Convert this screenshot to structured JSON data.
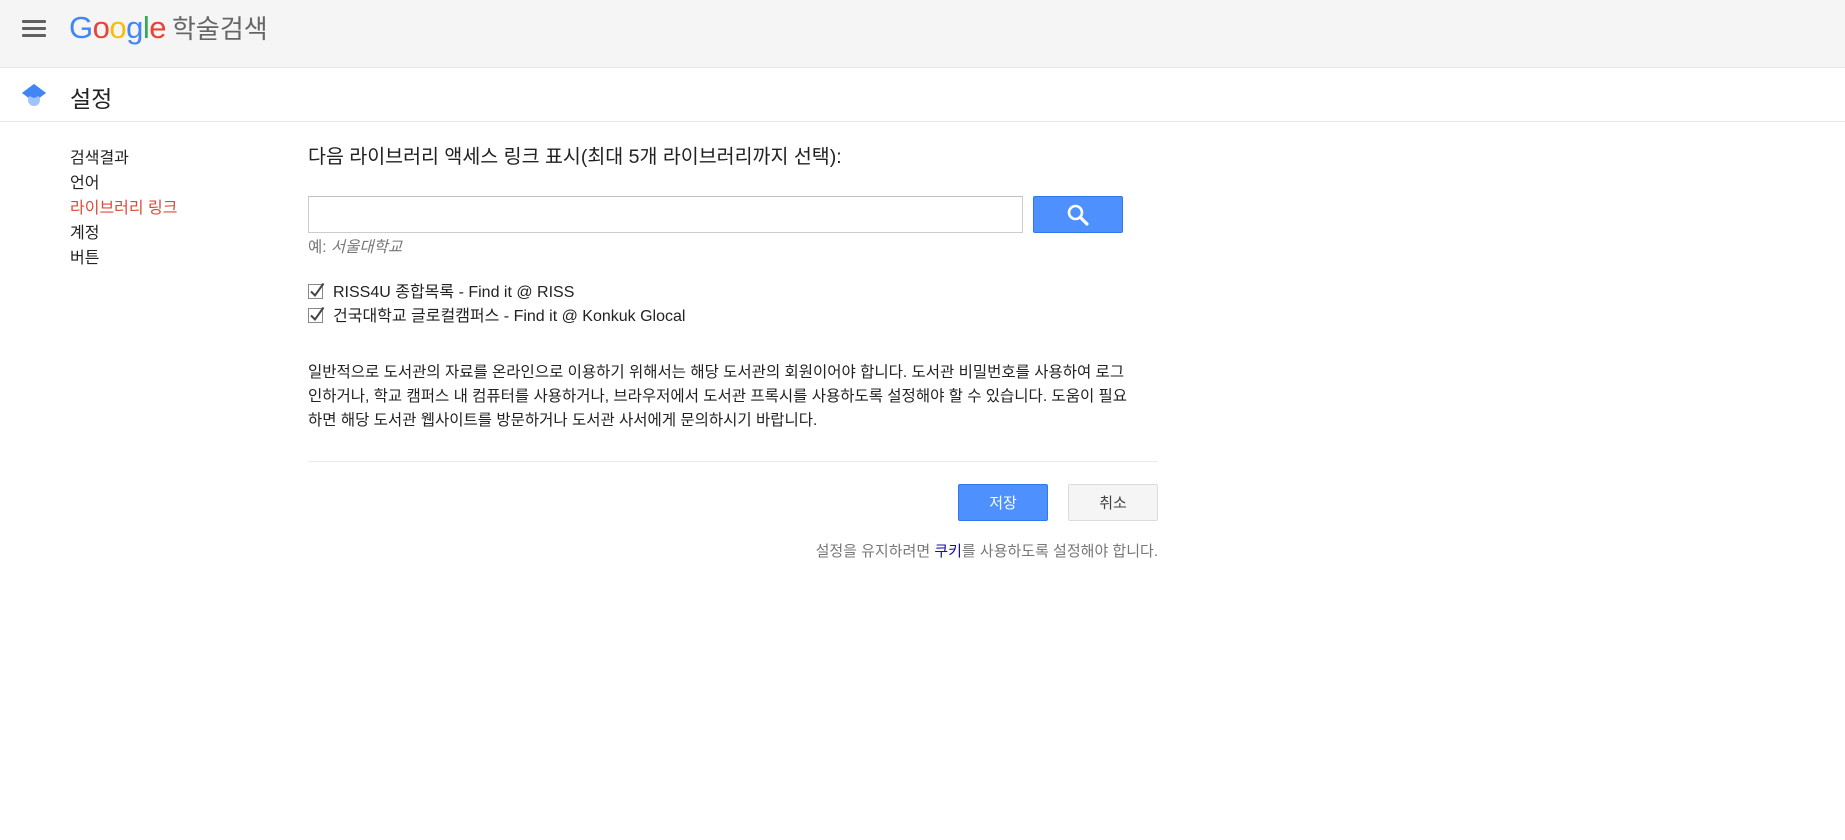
{
  "header": {
    "logo_letters": [
      "G",
      "o",
      "o",
      "g",
      "l",
      "e"
    ],
    "logo_suffix": "학술검색",
    "icons": {
      "menu": "hamburger-menu-icon",
      "product": "scholar-cap-icon",
      "search": "magnifier-icon",
      "check": "checkmark-icon"
    }
  },
  "title_bar": {
    "title": "설정"
  },
  "sidebar": {
    "items": [
      {
        "label": "검색결과",
        "active": false
      },
      {
        "label": "언어",
        "active": false
      },
      {
        "label": "라이브러리 링크",
        "active": true
      },
      {
        "label": "계정",
        "active": false
      },
      {
        "label": "버튼",
        "active": false
      }
    ]
  },
  "main": {
    "heading": "다음 라이브러리 액세스 링크 표시(최대 5개 라이브러리까지 선택):",
    "search": {
      "value": "",
      "placeholder": ""
    },
    "example_prefix": "예: ",
    "example_value": "서울대학교",
    "libraries": [
      {
        "label": "RISS4U 종합목록 - Find it @ RISS",
        "checked": true
      },
      {
        "label": "건국대학교 글로컬캠퍼스 - Find it @ Konkuk Glocal",
        "checked": true
      }
    ],
    "info_text": "일반적으로 도서관의 자료를 온라인으로 이용하기 위해서는 해당 도서관의 회원이어야 합니다. 도서관 비밀번호를 사용하여 로그인하거나, 학교 캠퍼스 내 컴퓨터를 사용하거나, 브라우저에서 도서관 프록시를 사용하도록 설정해야 할 수 있습니다. 도움이 필요하면 해당 도서관 웹사이트를 방문하거나 도서관 사서에게 문의하시기 바랍니다.",
    "save_label": "저장",
    "cancel_label": "취소",
    "cookie_before": "설정을 유지하려면 ",
    "cookie_link": "쿠키",
    "cookie_after": "를 사용하도록 설정해야 합니다."
  },
  "colors": {
    "accent_blue": "#4d90fe",
    "active_red": "#dd4b39",
    "link": "#1a0dab",
    "header_bg": "#f5f5f5"
  }
}
